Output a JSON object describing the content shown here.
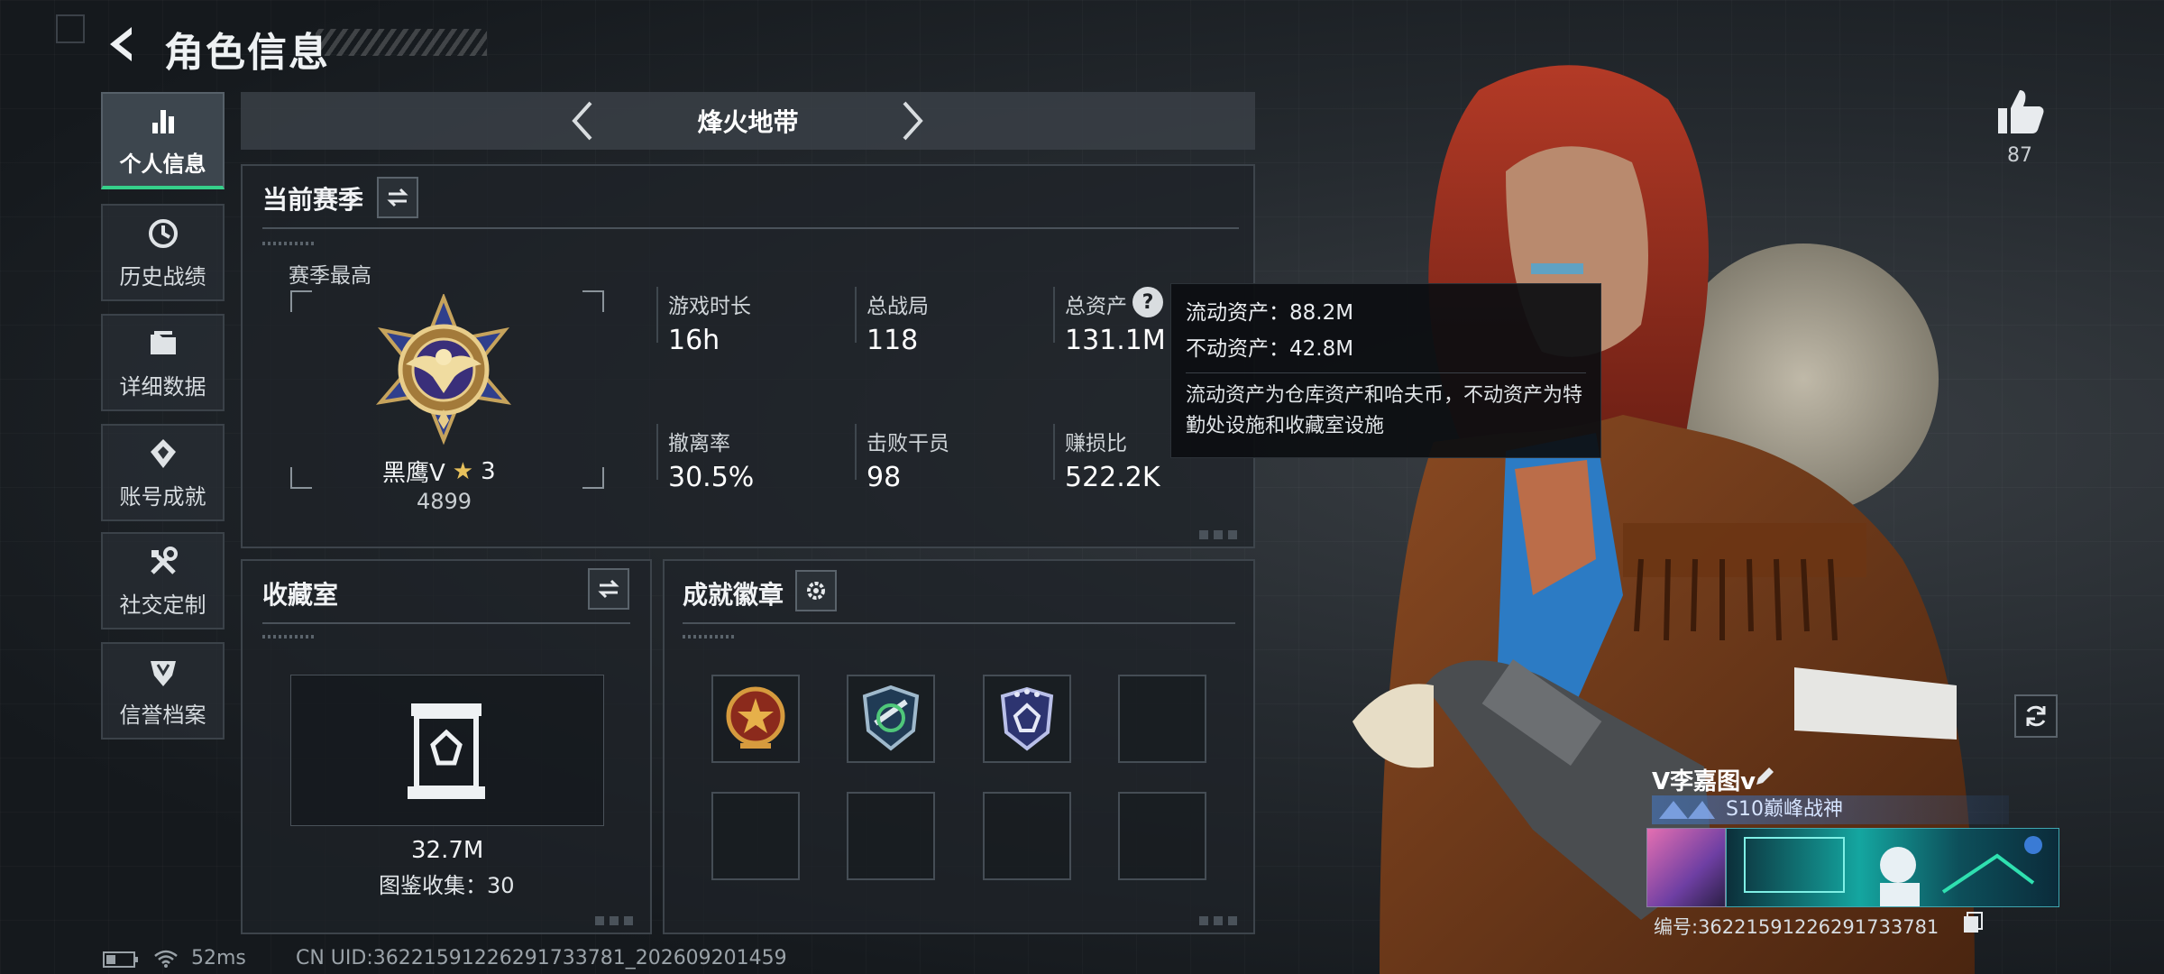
{
  "page": {
    "title": "角色信息"
  },
  "sidebar": {
    "items": [
      {
        "label": "个人信息",
        "icon": "bar-chart-icon",
        "active": true
      },
      {
        "label": "历史战绩",
        "icon": "clock-icon",
        "active": false
      },
      {
        "label": "详细数据",
        "icon": "folder-icon",
        "active": false
      },
      {
        "label": "账号成就",
        "icon": "medal-icon",
        "active": false
      },
      {
        "label": "社交定制",
        "icon": "tools-icon",
        "active": false
      },
      {
        "label": "信誉档案",
        "icon": "shield-icon",
        "active": false
      }
    ]
  },
  "mode": {
    "title": "烽火地带"
  },
  "season": {
    "title": "当前赛季",
    "best_label": "赛季最高",
    "rank_name": "黑鹰V",
    "rank_stars": "3",
    "rank_score": "4899",
    "stats": [
      {
        "label": "游戏时长",
        "value": "16h"
      },
      {
        "label": "总战局",
        "value": "118"
      },
      {
        "label": "总资产",
        "value": "131.1M"
      },
      {
        "label": "撤离率",
        "value": "30.5%"
      },
      {
        "label": "击败干员",
        "value": "98"
      },
      {
        "label": "赚损比",
        "value": "522.2K"
      }
    ]
  },
  "tooltip": {
    "liquid": "流动资产：88.2M",
    "fixed": "不动资产：42.8M",
    "desc": "流动资产为仓库资产和哈夫币，不动资产为特勤处设施和收藏室设施"
  },
  "collection": {
    "title": "收藏室",
    "value": "32.7M",
    "codex": "图鉴收集：30"
  },
  "achievements": {
    "title": "成就徽章",
    "badges": [
      "star-badge",
      "wing-badge",
      "crest-badge",
      "",
      "",
      "",
      "",
      ""
    ]
  },
  "player": {
    "likes": "87",
    "name": "V李嘉图v",
    "title": "S10巅峰战神",
    "id_text": "编号:3622159122629173378​1"
  },
  "status": {
    "ping": "52ms",
    "uid": "CN UID:3622159122629173378​1_202609201459"
  },
  "colors": {
    "accent": "#35d08a",
    "panel": "#1e2328",
    "tooltip_bg": "#0c0e11"
  }
}
